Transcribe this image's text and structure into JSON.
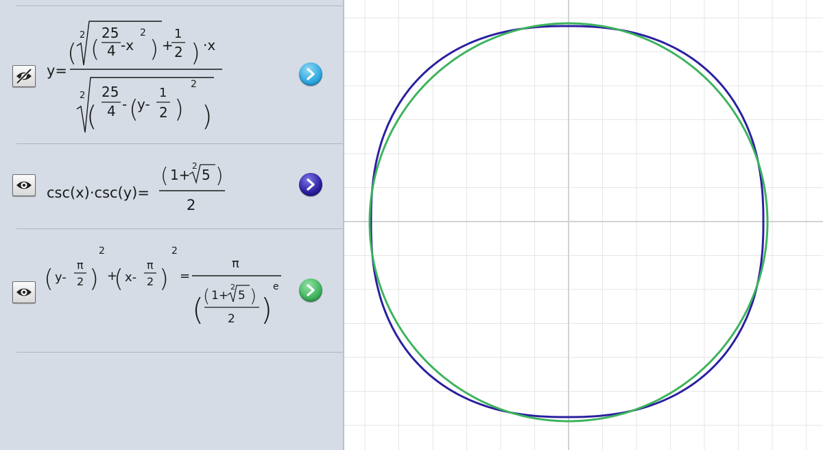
{
  "equations": [
    {
      "id": "eq1",
      "visible": false,
      "color": "#2ea8e0",
      "lhs": "y=",
      "root_index": "2",
      "numerator": {
        "frac_top": "25",
        "frac_bottom": "4",
        "minus_x": "-x",
        "exp": "2",
        "plus": "+",
        "half_top": "1",
        "half_bottom": "2",
        "times_x": "·x"
      },
      "denominator": {
        "frac_top": "25",
        "frac_bottom": "4",
        "minus": "-",
        "y_minus": "y-",
        "half_top": "1",
        "half_bottom": "2",
        "exp": "2"
      }
    },
    {
      "id": "eq2",
      "visible": true,
      "color": "#2a1fa0",
      "lhs": "csc(x)·csc(y)=",
      "rhs_numerator": "1+",
      "root_index": "2",
      "radicand": "5",
      "rhs_denominator": "2"
    },
    {
      "id": "eq3",
      "visible": true,
      "color": "#3db35c",
      "term1_var": "y-",
      "term2_var": "x-",
      "pi": "π",
      "two": "2",
      "exp": "2",
      "plus": "+",
      "equals": "=",
      "rhs_pi": "π",
      "rhs_inner": "1+",
      "root_index": "2",
      "radicand": "5",
      "rhs_inner_den": "2",
      "power": "e"
    }
  ],
  "graph": {
    "grid_color": "#e6e6e6",
    "axis_color": "#d2d2d2",
    "curves": [
      {
        "equation": "eq2",
        "color": "#2a1fa0"
      },
      {
        "equation": "eq3",
        "color": "#3db35c"
      }
    ]
  }
}
